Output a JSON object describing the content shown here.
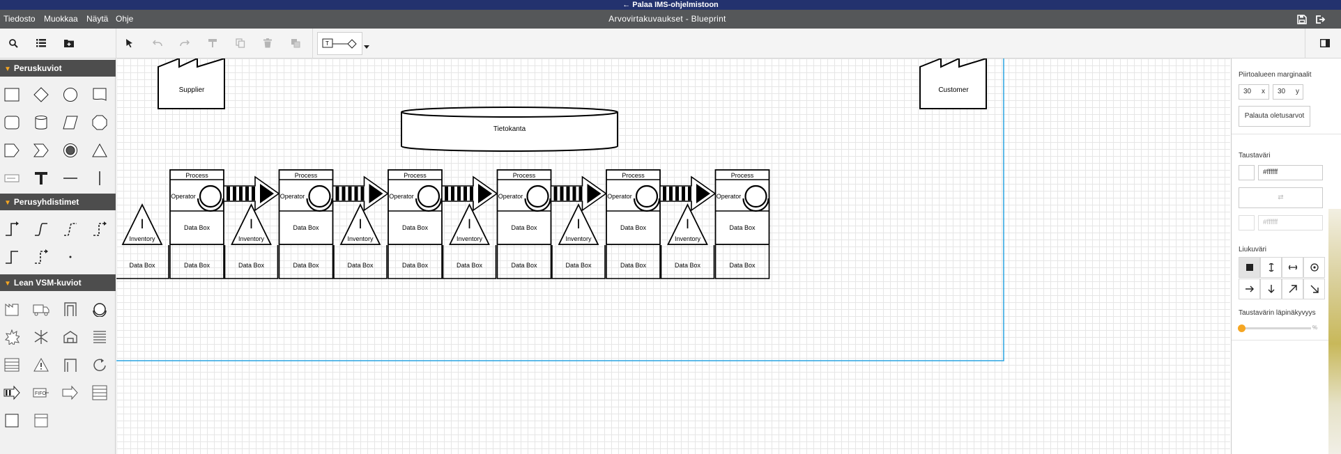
{
  "banner": {
    "back_link": "← Palaa IMS-ohjelmistoon"
  },
  "menubar": {
    "items": [
      "Tiedosto",
      "Muokkaa",
      "Näytä",
      "Ohje"
    ],
    "title": "Arvovirtakuvaukset - Blueprint",
    "icons": [
      "save-icon",
      "exit-icon"
    ]
  },
  "toolbar": {
    "icons": [
      "search-icon",
      "list-icon",
      "new-folder-icon",
      "pointer-icon",
      "undo-icon",
      "redo-icon",
      "format-paint-icon",
      "copy-icon",
      "delete-icon",
      "duplicate-icon",
      "connector-style-icon",
      "panel-toggle-icon"
    ]
  },
  "sidebar": {
    "sections": [
      {
        "title": "Peruskuviot"
      },
      {
        "title": "Perusyhdistimet"
      },
      {
        "title": "Lean VSM-kuviot"
      }
    ]
  },
  "diagram": {
    "supplier": "Supplier",
    "customer": "Customer",
    "database": "Tietokanta",
    "process_label": "Process",
    "operator_label": "Operator",
    "databox_label": "Data Box",
    "inventory_label": "Inventory",
    "inventory_symbol": "I",
    "colors": {
      "page_border": "#29a3e0",
      "stroke": "#000000",
      "fill": "#ffffff"
    }
  },
  "rightpanel": {
    "margins_label": "Piirtoalueen marginaalit",
    "margin_x": "30",
    "margin_x_unit": "x",
    "margin_y": "30",
    "margin_y_unit": "y",
    "reset_button": "Palauta oletusarvot",
    "bg_color_label": "Taustaväri",
    "bg_color_value": "#ffffff",
    "gradient_color_value": "#ffffff",
    "gradient_label": "Liukuväri",
    "opacity_label": "Taustavärin läpinäkyvyys",
    "opacity_value_label": "%",
    "opacity_value": 0,
    "accent_color": "#f5a623"
  }
}
